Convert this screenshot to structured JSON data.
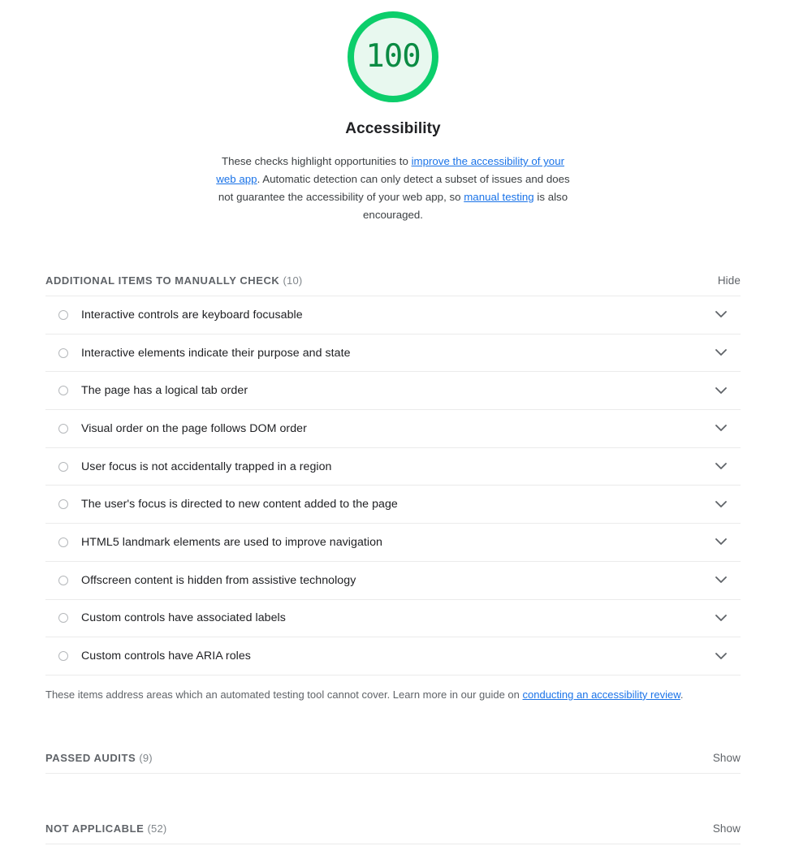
{
  "score": {
    "value": "100",
    "category": "Accessibility",
    "ring_color": "#0cce6b",
    "fill_color": "#e8f8ef",
    "text_color": "#0b8b43"
  },
  "description": {
    "part1": "These checks highlight opportunities to ",
    "link1": "improve the accessibility of your web app",
    "part2": ". Automatic detection can only detect a subset of issues and does not guarantee the accessibility of your web app, so ",
    "link2": "manual testing",
    "part3": " is also encouraged."
  },
  "manual_section": {
    "title": "ADDITIONAL ITEMS TO MANUALLY CHECK",
    "count": "(10)",
    "toggle_label": "Hide",
    "items": [
      {
        "title": "Interactive controls are keyboard focusable"
      },
      {
        "title": "Interactive elements indicate their purpose and state"
      },
      {
        "title": "The page has a logical tab order"
      },
      {
        "title": "Visual order on the page follows DOM order"
      },
      {
        "title": "User focus is not accidentally trapped in a region"
      },
      {
        "title": "The user's focus is directed to new content added to the page"
      },
      {
        "title": "HTML5 landmark elements are used to improve navigation"
      },
      {
        "title": "Offscreen content is hidden from assistive technology"
      },
      {
        "title": "Custom controls have associated labels"
      },
      {
        "title": "Custom controls have ARIA roles"
      }
    ],
    "footer": {
      "part1": "These items address areas which an automated testing tool cannot cover. Learn more in our guide on ",
      "link": "conducting an accessibility review",
      "part2": "."
    }
  },
  "passed_section": {
    "title": "PASSED AUDITS",
    "count": "(9)",
    "toggle_label": "Show"
  },
  "na_section": {
    "title": "NOT APPLICABLE",
    "count": "(52)",
    "toggle_label": "Show"
  },
  "colors": {
    "link": "#1a73e8",
    "muted": "#5f6368",
    "divider": "#ebebeb"
  }
}
